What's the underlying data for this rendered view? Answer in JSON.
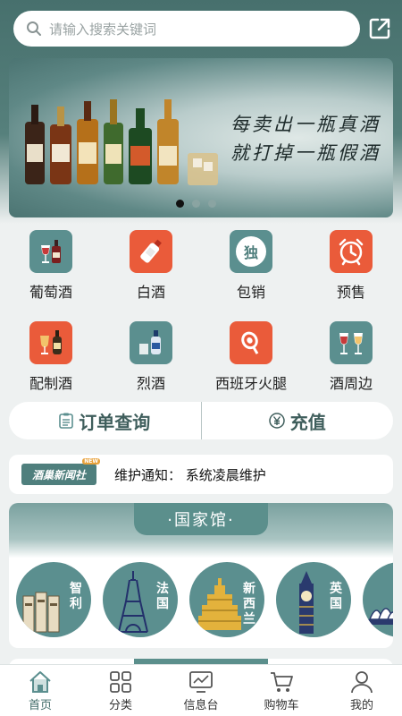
{
  "search": {
    "placeholder": "请输入搜索关键词"
  },
  "banner": {
    "slogan_line1": "每卖出一瓶真酒",
    "slogan_line2": "就打掉一瓶假酒",
    "page_count": 3,
    "active_index": 0
  },
  "categories": [
    {
      "label": "葡萄酒",
      "icon": "wine-glass-bottle-icon",
      "color": "#5b8f8f"
    },
    {
      "label": "白酒",
      "icon": "baijiu-bottle-icon",
      "color": "#ea5b3a"
    },
    {
      "label": "包销",
      "icon": "exclusive-badge-icon",
      "color": "#5b8f8f",
      "badge": "独"
    },
    {
      "label": "预售",
      "icon": "alarm-clock-icon",
      "color": "#ea5b3a"
    },
    {
      "label": "配制酒",
      "icon": "cocktail-bottle-icon",
      "color": "#ea5b3a"
    },
    {
      "label": "烈酒",
      "icon": "spirits-bottle-icon",
      "color": "#5b8f8f"
    },
    {
      "label": "西班牙火腿",
      "icon": "ham-icon",
      "color": "#ea5b3a"
    },
    {
      "label": "酒周边",
      "icon": "wine-glasses-icon",
      "color": "#5b8f8f"
    }
  ],
  "actions": {
    "order_query": "订单查询",
    "recharge": "充值"
  },
  "news": {
    "logo_text": "酒巢新闻社",
    "logo_badge": "NEW",
    "text": "维护通知：  系统凌晨维护"
  },
  "country_hall": {
    "title": "·国家馆·",
    "items": [
      {
        "name": "智利",
        "icon": "moai-icon"
      },
      {
        "name": "法国",
        "icon": "eiffel-tower-icon"
      },
      {
        "name": "新西兰",
        "icon": "building-icon"
      },
      {
        "name": "英国",
        "icon": "big-ben-icon"
      },
      {
        "name": "",
        "icon": "opera-house-icon"
      }
    ]
  },
  "tabbar": [
    {
      "label": "首页",
      "icon": "home-icon",
      "active": true
    },
    {
      "label": "分类",
      "icon": "grid-icon",
      "active": false
    },
    {
      "label": "信息台",
      "icon": "monitor-icon",
      "active": false
    },
    {
      "label": "购物车",
      "icon": "cart-icon",
      "active": false
    },
    {
      "label": "我的",
      "icon": "user-icon",
      "active": false
    }
  ],
  "colors": {
    "accent": "#5b8f8f",
    "orange": "#ea5b3a",
    "header": "#47706d"
  }
}
